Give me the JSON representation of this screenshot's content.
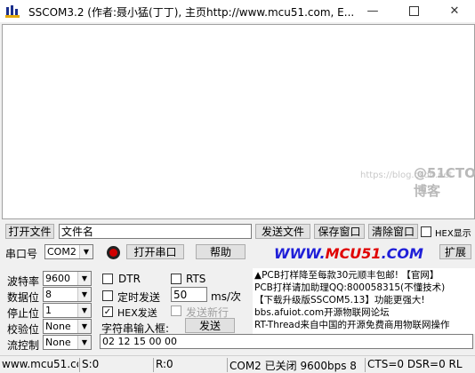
{
  "window": {
    "title": "SSCOM3.2 (作者:聂小猛(丁丁), 主页http://www.mcu51.com,  E...",
    "minimize_icon": "minimize-icon",
    "maximize_icon": "maximize-icon",
    "close_icon": "close-icon"
  },
  "watermark": {
    "text1": "https://blog.csdn.net",
    "text2": "@51CTO博客"
  },
  "file_row": {
    "open_file": "打开文件",
    "file_name_value": "文件名",
    "send_file": "发送文件",
    "save_window": "保存窗口",
    "clear_window": "清除窗口",
    "hex_display": "HEX显示"
  },
  "port_row": {
    "port_label": "串口号",
    "port_value": "COM2",
    "open_port": "打开串口",
    "help": "帮助",
    "site_part1": "WWW.",
    "site_part2": "MCU51",
    "site_part3": ".COM",
    "expand": "扩展"
  },
  "settings": {
    "baud_label": "波特率",
    "baud_value": "9600",
    "databits_label": "数据位",
    "databits_value": "8",
    "stopbits_label": "停止位",
    "stopbits_value": "1",
    "parity_label": "校验位",
    "parity_value": "None",
    "flow_label": "流控制",
    "flow_value": "None"
  },
  "options": {
    "dtr": "DTR",
    "rts": "RTS",
    "timed_send": "定时发送",
    "interval_value": "50",
    "interval_unit": "ms/次",
    "hex_send": "HEX发送",
    "send_newline": "发送新行",
    "input_label": "字符串输入框:",
    "send": "发送",
    "input_value": "02 12 15 00 00"
  },
  "ads": [
    "▲PCB打样降至每款30元顺丰包邮! 【官网】",
    "PCB打样请加助理QQ:800058315(不懂技术)",
    "【下载升级版SSCOM5.13】功能更强大!",
    "bbs.afuiot.com开源物联网论坛",
    "RT-Thread来自中国的开源免费商用物联网操作"
  ],
  "status_bar": {
    "site": "www.mcu51.cor",
    "sent": "S:0",
    "received": "R:0",
    "port_status": "COM2 已关闭  9600bps  8",
    "signals": "CTS=0 DSR=0 RL"
  }
}
